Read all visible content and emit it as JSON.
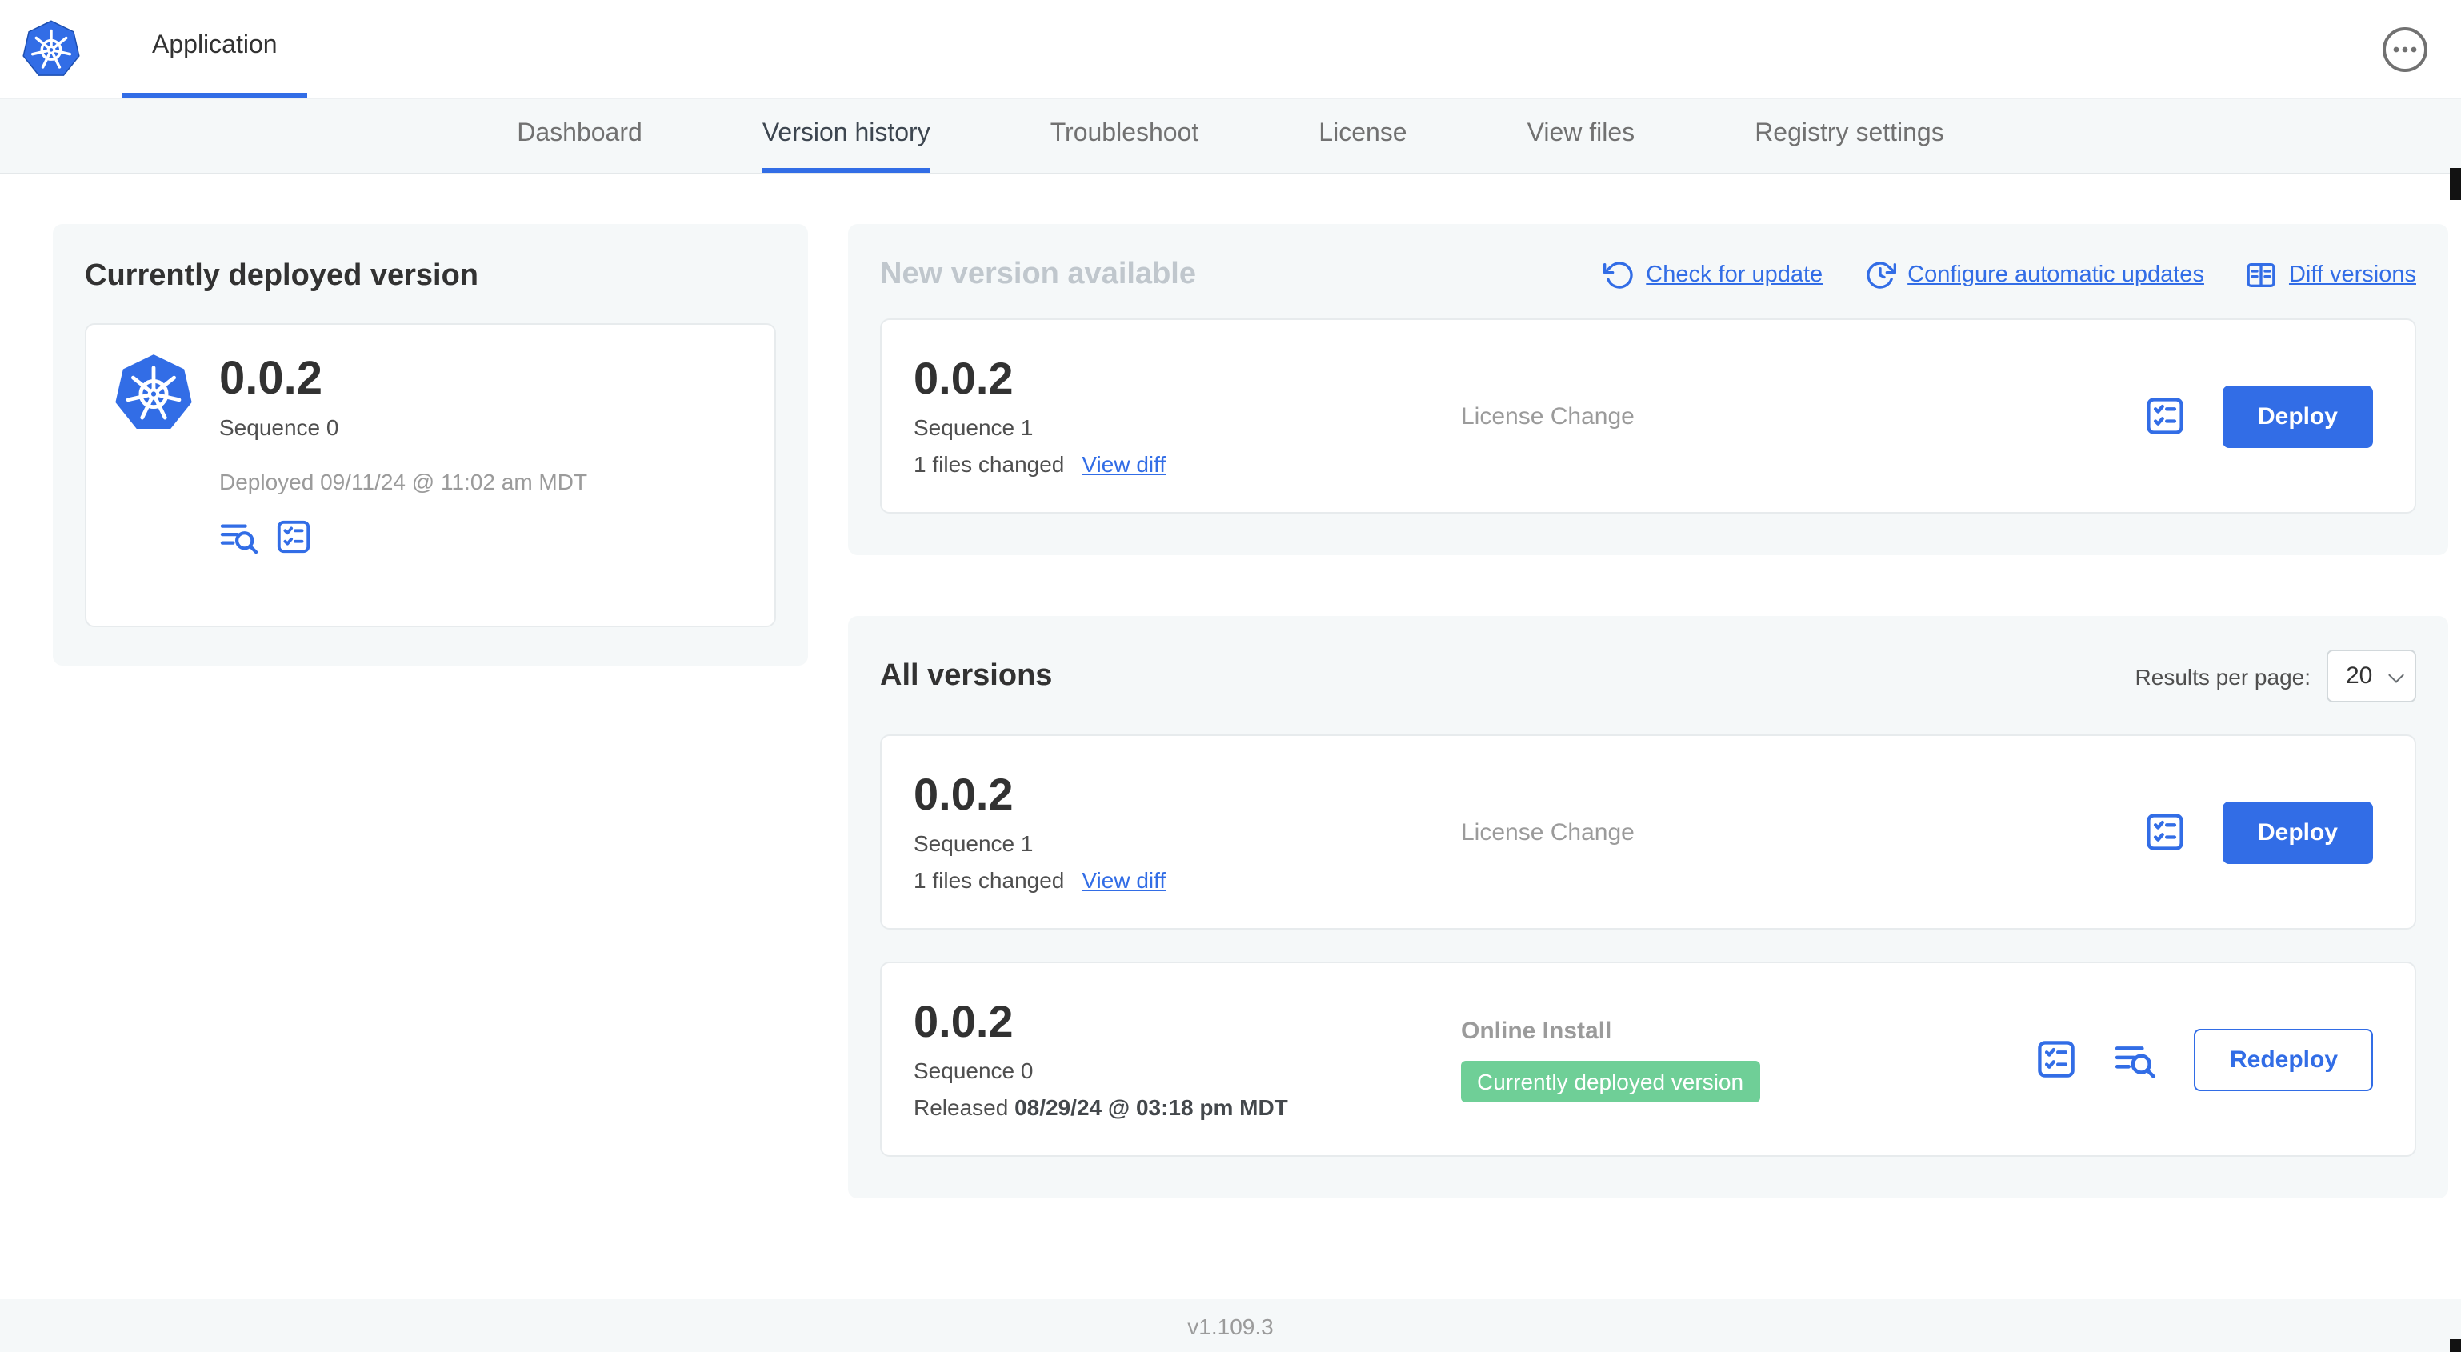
{
  "colors": {
    "accent_blue": "#326de6",
    "badge_green": "#6fcf97",
    "panel_bg": "#f5f8f9"
  },
  "header": {
    "app_tab_label": "Application",
    "more_menu_icon": "ellipsis-circle",
    "logo_icon": "kubernetes-wheel"
  },
  "subnav": {
    "active_tab": "Version history",
    "tabs": [
      {
        "label": "Dashboard"
      },
      {
        "label": "Version history"
      },
      {
        "label": "Troubleshoot"
      },
      {
        "label": "License"
      },
      {
        "label": "View files"
      },
      {
        "label": "Registry settings"
      }
    ]
  },
  "currently_deployed": {
    "title": "Currently deployed version",
    "version": "0.0.2",
    "sequence": "Sequence 0",
    "deployed_timestamp": "Deployed 09/11/24 @ 11:02 am MDT",
    "icons": [
      "release-notes",
      "preflight-checks"
    ]
  },
  "new_version": {
    "title": "New version available",
    "actions": {
      "check_for_update": "Check for update",
      "configure_automatic_updates": "Configure automatic updates",
      "diff_versions": "Diff versions"
    },
    "card": {
      "version": "0.0.2",
      "sequence": "Sequence 1",
      "files_changed": "1 files changed",
      "view_diff": "View diff",
      "source": "License Change",
      "deploy": "Deploy"
    }
  },
  "all_versions": {
    "title": "All versions",
    "results_per_page_label": "Results per page:",
    "results_per_page_value": "20",
    "rows": [
      {
        "version": "0.0.2",
        "sequence": "Sequence 1",
        "files_changed": "1 files changed",
        "view_diff": "View diff",
        "source": "License Change",
        "action": "Deploy"
      },
      {
        "version": "0.0.2",
        "sequence": "Sequence 0",
        "released_prefix": "Released",
        "released_date": "08/29/24 @ 03:18 pm MDT",
        "source": "Online Install",
        "badge": "Currently deployed version",
        "action": "Redeploy"
      }
    ]
  },
  "footer": {
    "console_version": "v1.109.3"
  }
}
